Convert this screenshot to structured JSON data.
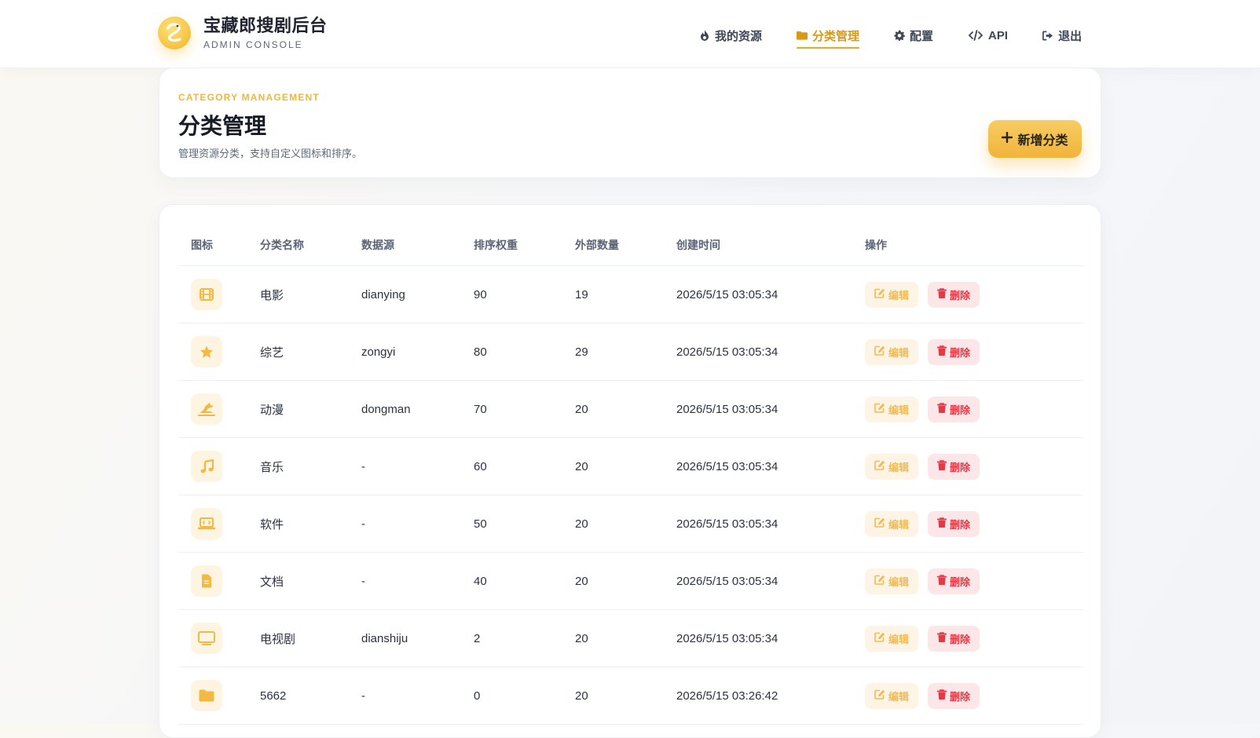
{
  "brand": {
    "title": "宝藏郎搜剧后台",
    "subtitle": "ADMIN CONSOLE"
  },
  "nav": [
    {
      "label": "我的资源",
      "icon": "fire-icon"
    },
    {
      "label": "分类管理",
      "icon": "folder-icon",
      "active": true
    },
    {
      "label": "配置",
      "icon": "gear-icon"
    },
    {
      "label": "API",
      "icon": "code-icon"
    },
    {
      "label": "退出",
      "icon": "logout-icon"
    }
  ],
  "header": {
    "eyebrow": "CATEGORY MANAGEMENT",
    "title": "分类管理",
    "description": "管理资源分类，支持自定义图标和排序。",
    "add_button": "新增分类"
  },
  "table": {
    "columns": [
      "图标",
      "分类名称",
      "数据源",
      "排序权重",
      "外部数量",
      "创建时间",
      "操作"
    ],
    "edit_label": "编辑",
    "delete_label": "删除",
    "rows": [
      {
        "icon": "film-icon",
        "name": "电影",
        "source": "dianying",
        "weight": "90",
        "count": "19",
        "created": "2026/5/15 03:05:34"
      },
      {
        "icon": "star-icon",
        "name": "综艺",
        "source": "zongyi",
        "weight": "80",
        "count": "29",
        "created": "2026/5/15 03:05:34"
      },
      {
        "icon": "dragon-icon",
        "name": "动漫",
        "source": "dongman",
        "weight": "70",
        "count": "20",
        "created": "2026/5/15 03:05:34"
      },
      {
        "icon": "music-icon",
        "name": "音乐",
        "source": "-",
        "weight": "60",
        "count": "20",
        "created": "2026/5/15 03:05:34"
      },
      {
        "icon": "laptop-code-icon",
        "name": "软件",
        "source": "-",
        "weight": "50",
        "count": "20",
        "created": "2026/5/15 03:05:34"
      },
      {
        "icon": "document-icon",
        "name": "文档",
        "source": "-",
        "weight": "40",
        "count": "20",
        "created": "2026/5/15 03:05:34"
      },
      {
        "icon": "tv-icon",
        "name": "电视剧",
        "source": "dianshiju",
        "weight": "2",
        "count": "20",
        "created": "2026/5/15 03:05:34"
      },
      {
        "icon": "folder-icon",
        "name": "5662",
        "source": "-",
        "weight": "0",
        "count": "20",
        "created": "2026/5/15 03:26:42"
      }
    ]
  },
  "colors": {
    "accent": "#f0b43a",
    "accent_text": "#d69a16",
    "danger": "#e53945",
    "icon_bg": "#fdf4e2"
  }
}
